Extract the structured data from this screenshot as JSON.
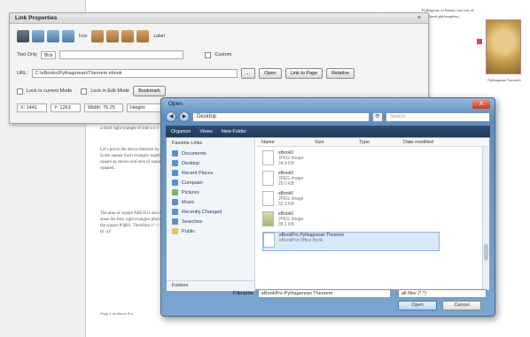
{
  "link_properties": {
    "title": "Link Properties",
    "close": "×",
    "toolbar": [
      "Icon",
      "Label"
    ],
    "row1": {
      "label": "Text Only",
      "select": "Blck",
      "checkbox": "Custom"
    },
    "url": {
      "label": "URL:",
      "value": "C:\\eBooks\\Pythagorean\\Theorem.ebook",
      "browse": "...",
      "open": "Open",
      "link_page": "Link to Page",
      "relative": "Relative"
    },
    "row3": {
      "check1": "Lock in current Mode",
      "check2": "Lock in Edit Mode",
      "button": "Bookmark"
    },
    "coords": [
      "X: 1441",
      "Y: 1263",
      "Width: 76.25",
      "Height:"
    ]
  },
  "open_dialog": {
    "title": "Open",
    "close": "X",
    "address": "Desktop",
    "search_placeholder": "Search",
    "toolbar": [
      "Organize",
      "Views",
      "New Folder"
    ],
    "favorites_header": "Favorite Links",
    "favorites": [
      "Documents",
      "Desktop",
      "Recent Places",
      "Computer",
      "Pictures",
      "Music",
      "Recently Changed",
      "Searches",
      "Public"
    ],
    "folders": "Folders",
    "columns": [
      "Name",
      "Size",
      "Type",
      "Date modified"
    ],
    "files": [
      {
        "name": "eBook0",
        "sub": "JPEG Image",
        "size": "34.9 KB",
        "type": "image"
      },
      {
        "name": "eBook0",
        "sub": "JPEG Image",
        "size": "29.0 KB",
        "type": "image"
      },
      {
        "name": "eBook0",
        "sub": "JPEG Image",
        "size": "32.3 KB",
        "type": "image"
      },
      {
        "name": "eBook0",
        "sub": "JPEG Image",
        "size": "38.1 KB",
        "type": "image"
      },
      {
        "name": "eBookPro Pythagorean Theorem",
        "sub": "eBookPro Office Book",
        "size": "",
        "type": "ebook"
      }
    ],
    "filename_label": "Filename:",
    "filename_value": "eBookPro Pythagorean Theorem",
    "filetype": "all files (*.*)",
    "open_btn": "Open",
    "cancel_btn": "Cancel"
  },
  "background": {
    "footer": "Page 1 of eBook Pro",
    "right_text": "Pythagoras of Samos was one of the Greek philosophers.",
    "portrait_caption": "Pythagoras Theorem"
  }
}
